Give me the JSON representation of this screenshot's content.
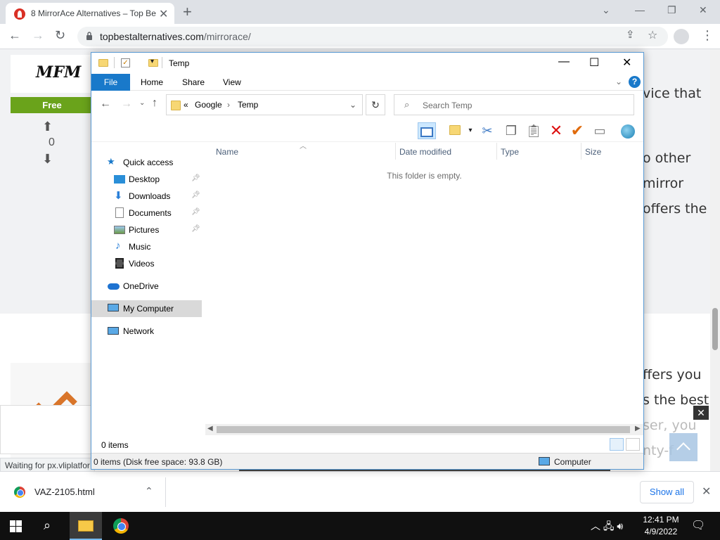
{
  "browser": {
    "tab_title": "8 MirrorAce Alternatives – Top Be",
    "tab_close": "✕",
    "new_tab": "+",
    "url_host": "topbestalternatives.com",
    "url_path": "/mirrorace/",
    "status_text": "Waiting for px.vliplatfor"
  },
  "page": {
    "logo_text": "MFM",
    "badge": "Free",
    "vote_count": "0",
    "text_lines": [
      "vice that",
      "o other",
      "mirror",
      "offers the",
      "ffers you",
      "s the best",
      "ser, you",
      "nty-f"
    ],
    "ad_close": "✕"
  },
  "explorer": {
    "title": "Temp",
    "ribbon_tabs": {
      "file": "File",
      "home": "Home",
      "share": "Share",
      "view": "View"
    },
    "help": "?",
    "address": {
      "prefix": "«",
      "seg1": "Google",
      "sep": "›",
      "seg2": "Temp"
    },
    "search_placeholder": "Search Temp",
    "nav": {
      "quick_access": "Quick access",
      "desktop": "Desktop",
      "downloads": "Downloads",
      "documents": "Documents",
      "pictures": "Pictures",
      "music": "Music",
      "videos": "Videos",
      "onedrive": "OneDrive",
      "my_computer": "My Computer",
      "network": "Network"
    },
    "columns": {
      "name": "Name",
      "date": "Date modified",
      "type": "Type",
      "size": "Size"
    },
    "empty_message": "This folder is empty.",
    "item_count": "0 items",
    "details_left": "0 items (Disk free space: 93.8 GB)",
    "details_right": "Computer"
  },
  "downloads": {
    "file_name": "VAZ-2105.html",
    "show_all": "Show all"
  },
  "taskbar": {
    "time": "12:41 PM",
    "date": "4/9/2022"
  },
  "colors": {
    "accent": "#1979ca",
    "badge_green": "#6aa31b",
    "link_blue": "#1a73e8"
  }
}
